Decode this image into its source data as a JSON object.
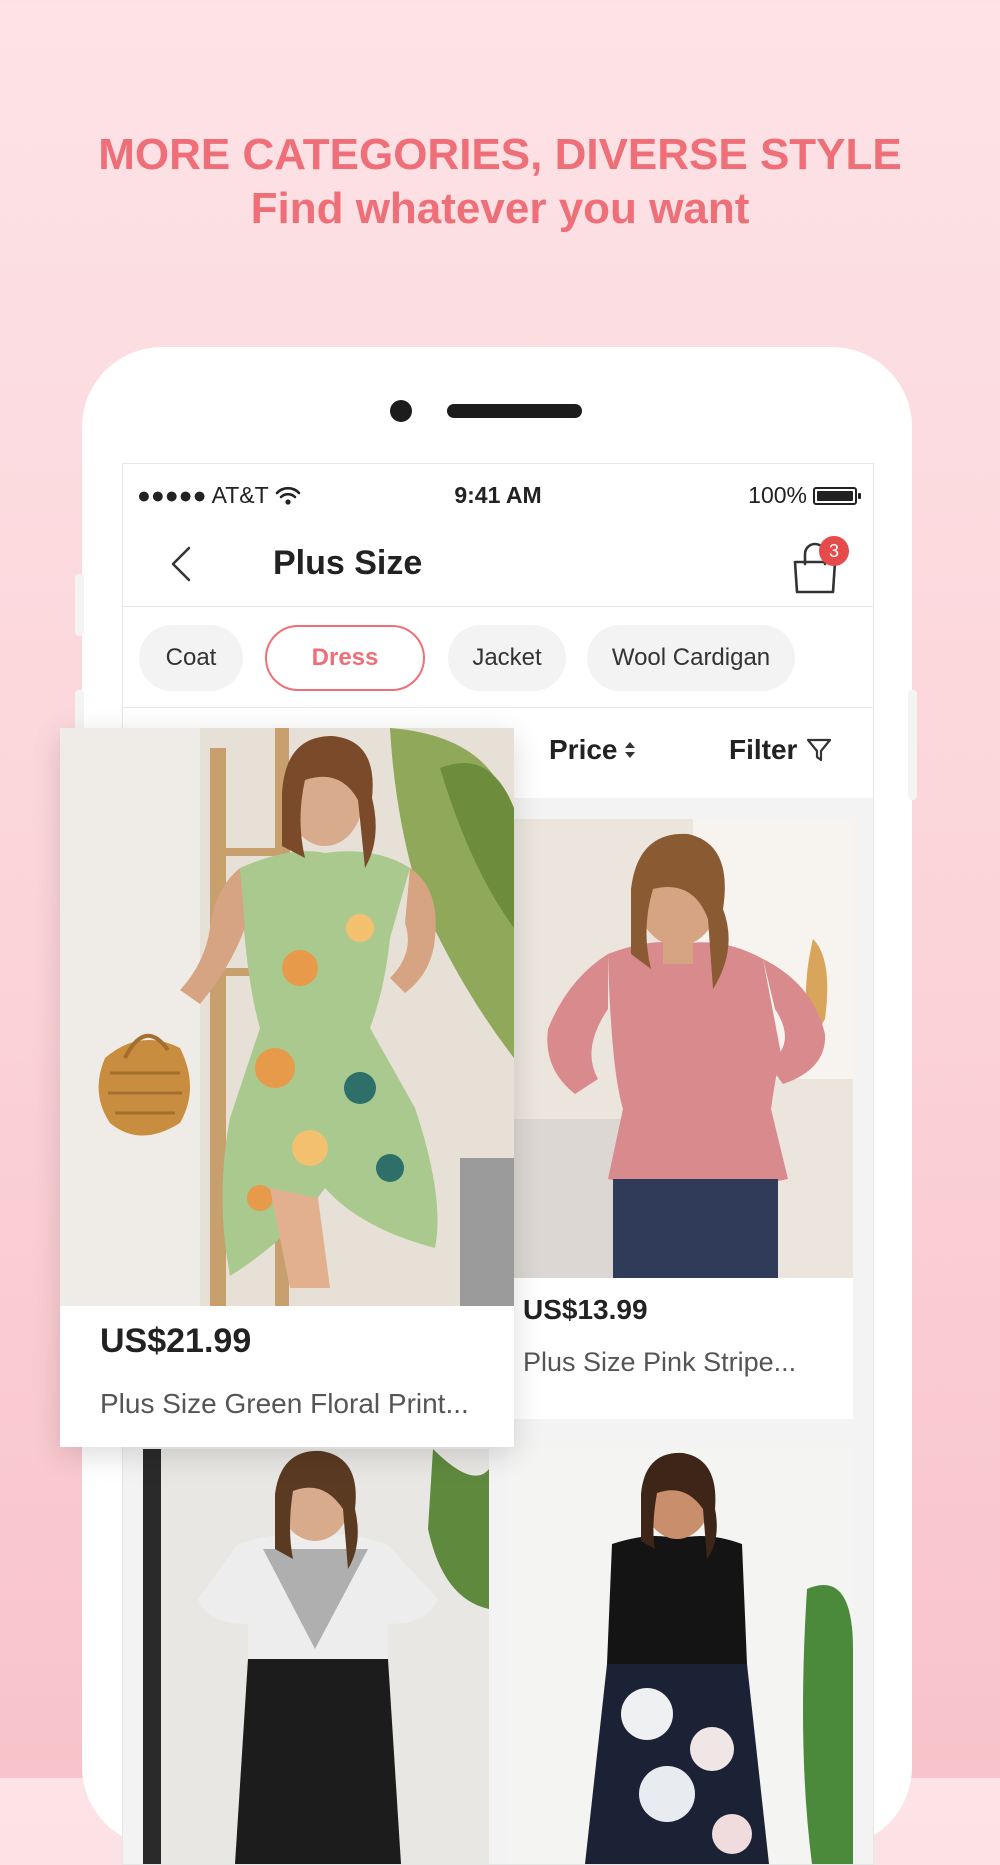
{
  "headline": {
    "line1": "MORE CATEGORIES, DIVERSE STYLE",
    "line2": "Find whatever you want"
  },
  "status_bar": {
    "carrier": "●●●●● AT&T",
    "time": "9:41 AM",
    "battery": "100%"
  },
  "nav": {
    "title": "Plus Size",
    "cart_count": "3"
  },
  "categories": [
    {
      "label": "Coat",
      "active": false
    },
    {
      "label": "Dress",
      "active": true
    },
    {
      "label": "Jacket",
      "active": false
    },
    {
      "label": "Wool Cardigan",
      "active": false
    }
  ],
  "sort": {
    "price_label": "Price",
    "filter_label": "Filter"
  },
  "products": [
    {
      "price": "US$21.99",
      "name": "Plus Size Green Floral Print..."
    },
    {
      "price": "US$13.99",
      "name": "Plus Size Pink Stripe..."
    }
  ],
  "colors": {
    "accent": "#ef6f78",
    "badge": "#e64b4b"
  }
}
